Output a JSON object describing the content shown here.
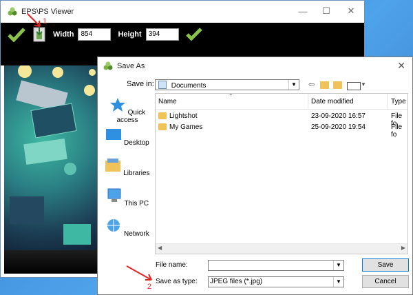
{
  "viewer": {
    "title": "EPS\\PS Viewer",
    "width_label": "Width",
    "width_value": "854",
    "height_label": "Height",
    "height_value": "394",
    "controls": {
      "minimize": "—",
      "maximize": "☐",
      "close": "✕"
    }
  },
  "dialog": {
    "title": "Save As",
    "close": "✕",
    "save_in_label": "Save in:",
    "save_in_value": "Documents",
    "places": [
      {
        "label": "Quick access",
        "icon": "quick-access-icon"
      },
      {
        "label": "Desktop",
        "icon": "desktop-icon"
      },
      {
        "label": "Libraries",
        "icon": "libraries-icon"
      },
      {
        "label": "This PC",
        "icon": "this-pc-icon"
      },
      {
        "label": "Network",
        "icon": "network-icon"
      }
    ],
    "columns": {
      "name": "Name",
      "date": "Date modified",
      "type": "Type"
    },
    "files": [
      {
        "name": "Lightshot",
        "date": "23-09-2020 16:57",
        "type": "File fo"
      },
      {
        "name": "My Games",
        "date": "25-09-2020 19:54",
        "type": "File fo"
      }
    ],
    "file_name_label": "File name:",
    "file_name_value": "",
    "save_type_label": "Save as type:",
    "save_type_value": "JPEG files (*.jpg)",
    "save_button": "Save",
    "cancel_button": "Cancel"
  },
  "annotations": {
    "step1": "1",
    "step2": "2"
  }
}
